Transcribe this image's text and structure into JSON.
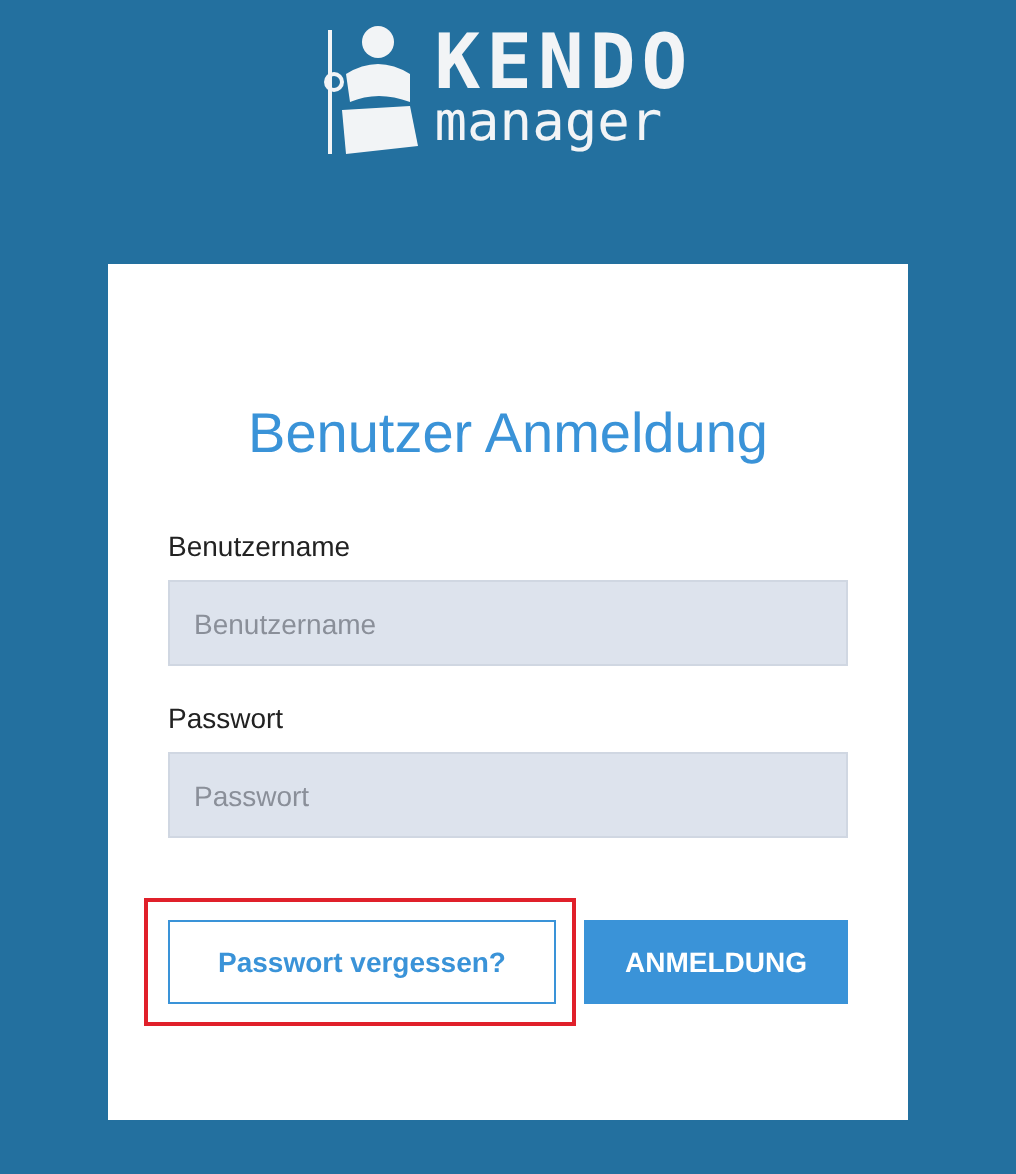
{
  "logo": {
    "title": "KENDO",
    "subtitle": "manager"
  },
  "form": {
    "title": "Benutzer Anmeldung",
    "fields": [
      {
        "label": "Benutzername",
        "placeholder": "Benutzername"
      },
      {
        "label": "Passwort",
        "placeholder": "Passwort"
      }
    ],
    "buttons": [
      {
        "label": "Passwort vergessen?",
        "kind": "outline",
        "highlighted": true
      },
      {
        "label": "ANMELDUNG",
        "kind": "primary",
        "highlighted": false
      }
    ]
  }
}
